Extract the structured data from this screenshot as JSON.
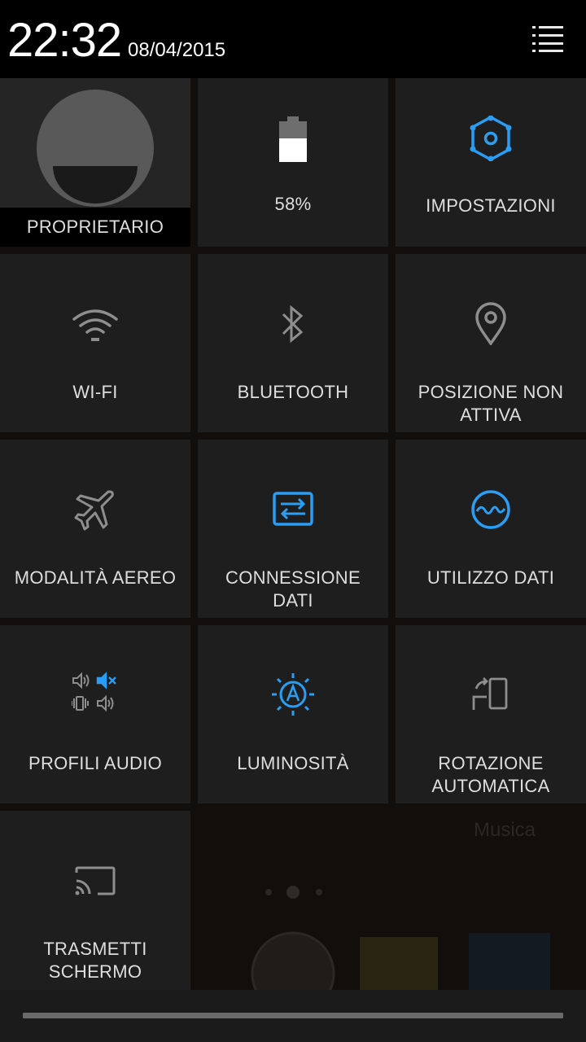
{
  "status": {
    "time": "22:32",
    "date": "08/04/2015"
  },
  "tiles": {
    "owner": {
      "label": "PROPRIETARIO"
    },
    "battery": {
      "label": "58%",
      "level": 0.58
    },
    "settings": {
      "label": "IMPOSTAZIONI"
    },
    "wifi": {
      "label": "WI-FI"
    },
    "bluetooth": {
      "label": "BLUETOOTH"
    },
    "location": {
      "label_line1": "POSIZIONE NON",
      "label_line2": "ATTIVA"
    },
    "airplane": {
      "label": "MODALITÀ AEREO"
    },
    "data": {
      "label_line1": "CONNESSIONE",
      "label_line2": "DATI"
    },
    "data_usage": {
      "label": "UTILIZZO DATI"
    },
    "audio": {
      "label": "PROFILI AUDIO"
    },
    "brightness": {
      "label": "LUMINOSITÀ"
    },
    "rotation": {
      "label_line1": "ROTAZIONE",
      "label_line2": "AUTOMATICA"
    },
    "cast": {
      "label_line1": "TRASMETTI",
      "label_line2": "SCHERMO"
    }
  },
  "background": {
    "widget_label": "Musica"
  },
  "colors": {
    "accent": "#2a9df4",
    "inactive_icon": "#8e8e8e",
    "tile": "#1e1e1e"
  }
}
